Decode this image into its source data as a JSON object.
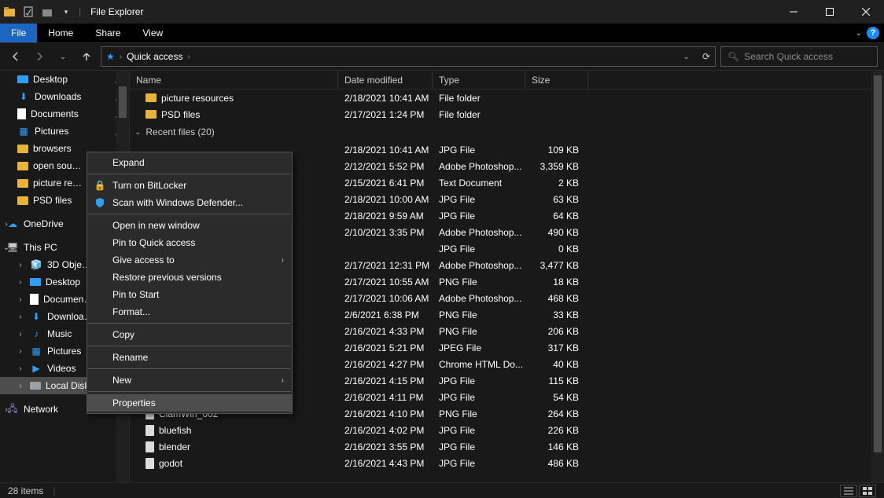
{
  "titlebar": {
    "title": "File Explorer"
  },
  "ribbon": {
    "file": "File",
    "home": "Home",
    "share": "Share",
    "view": "View"
  },
  "address": {
    "location": "Quick access",
    "search_placeholder": "Search Quick access"
  },
  "nav": {
    "desktop": "Desktop",
    "downloads": "Downloads",
    "documents": "Documents",
    "pictures": "Pictures",
    "browsers": "browsers",
    "open_sou": "open sou…",
    "picture_re": "picture re…",
    "psd_files": "PSD files",
    "onedrive": "OneDrive",
    "thispc": "This PC",
    "threed": "3D Obje…",
    "desktop2": "Desktop",
    "documen": "Documen…",
    "downloa": "Downloa…",
    "music": "Music",
    "pictures2": "Pictures",
    "videos": "Videos",
    "localdisk": "Local Disk (C:)",
    "network": "Network"
  },
  "columns": {
    "name": "Name",
    "date": "Date modified",
    "type": "Type",
    "size": "Size"
  },
  "folders": [
    {
      "name": "picture resources",
      "date": "2/18/2021 10:41 AM",
      "type": "File folder"
    },
    {
      "name": "PSD files",
      "date": "2/17/2021 1:24 PM",
      "type": "File folder"
    }
  ],
  "recent_header": "Recent files (20)",
  "recent": [
    {
      "date": "2/18/2021 10:41 AM",
      "type": "JPG File",
      "size": "109 KB"
    },
    {
      "date": "2/12/2021 5:52 PM",
      "type": "Adobe Photoshop...",
      "size": "3,359 KB"
    },
    {
      "date": "2/15/2021 6:41 PM",
      "type": "Text Document",
      "size": "2 KB"
    },
    {
      "date": "2/18/2021 10:00 AM",
      "type": "JPG File",
      "size": "63 KB"
    },
    {
      "date": "2/18/2021 9:59 AM",
      "type": "JPG File",
      "size": "64 KB"
    },
    {
      "date": "2/10/2021 3:35 PM",
      "type": "Adobe Photoshop...",
      "size": "490 KB"
    },
    {
      "date": "",
      "type": "JPG File",
      "size": "0 KB"
    },
    {
      "date": "2/17/2021 12:31 PM",
      "type": "Adobe Photoshop...",
      "size": "3,477 KB"
    },
    {
      "date": "2/17/2021 10:55 AM",
      "type": "PNG File",
      "size": "18 KB"
    },
    {
      "date": "2/17/2021 10:06 AM",
      "type": "Adobe Photoshop...",
      "size": "468 KB"
    },
    {
      "date": "2/6/2021 6:38 PM",
      "type": "PNG File",
      "size": "33 KB"
    },
    {
      "date": "2/16/2021 4:33 PM",
      "type": "PNG File",
      "size": "206 KB"
    },
    {
      "date": "2/16/2021 5:21 PM",
      "type": "JPEG File",
      "size": "317 KB"
    },
    {
      "date": "2/16/2021 4:27 PM",
      "type": "Chrome HTML Do...",
      "size": "40 KB"
    },
    {
      "date": "2/16/2021 4:15 PM",
      "type": "JPG File",
      "size": "115 KB"
    },
    {
      "date": "2/16/2021 4:11 PM",
      "type": "JPG File",
      "size": "54 KB"
    },
    {
      "name": "ClamWin_002",
      "date": "2/16/2021 4:10 PM",
      "type": "PNG File",
      "size": "264 KB"
    },
    {
      "name": "bluefish",
      "date": "2/16/2021 4:02 PM",
      "type": "JPG File",
      "size": "226 KB"
    },
    {
      "name": "blender",
      "date": "2/16/2021 3:55 PM",
      "type": "JPG File",
      "size": "146 KB"
    },
    {
      "name": "godot",
      "date": "2/16/2021 4:43 PM",
      "type": "JPG File",
      "size": "486 KB"
    }
  ],
  "context_menu": {
    "expand": "Expand",
    "bitlocker": "Turn on BitLocker",
    "defender": "Scan with Windows Defender...",
    "open_new": "Open in new window",
    "pin_qa": "Pin to Quick access",
    "give_access": "Give access to",
    "restore": "Restore previous versions",
    "pin_start": "Pin to Start",
    "format": "Format...",
    "copy": "Copy",
    "rename": "Rename",
    "new": "New",
    "properties": "Properties"
  },
  "status": {
    "count": "28 items"
  }
}
